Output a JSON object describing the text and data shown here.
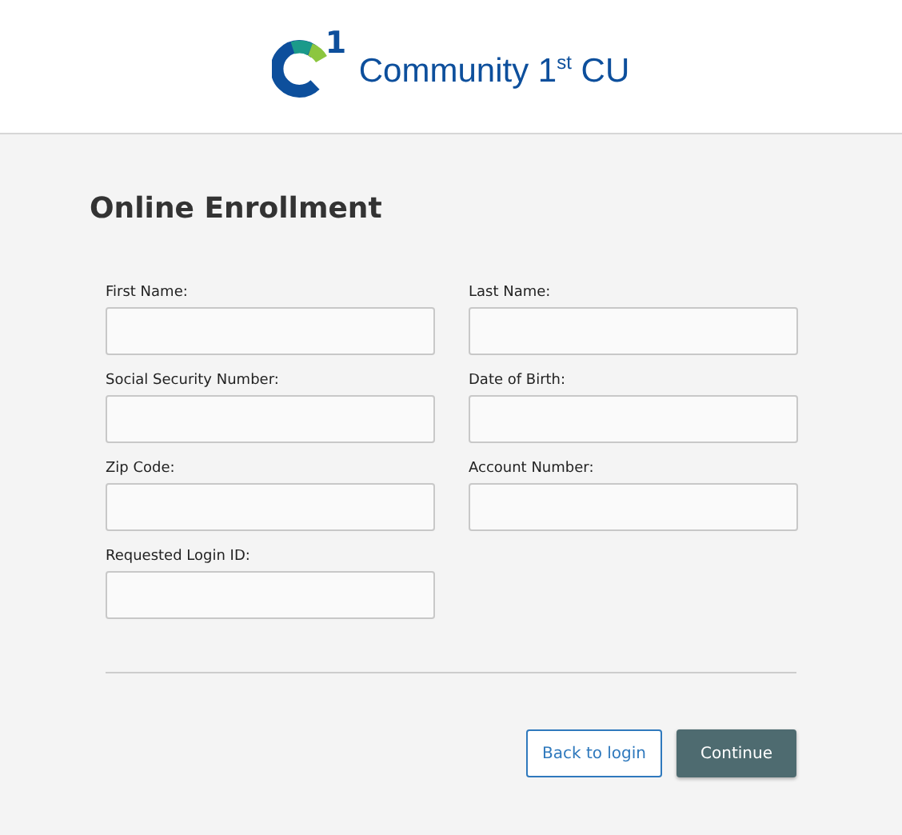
{
  "header": {
    "logo_mark": "1",
    "brand": "Community 1$^{st}$ CU"
  },
  "title": "Online Enrollment",
  "fields": [
    {
      "label": "First Name:"
    },
    {
      "label": "Last Name:"
    },
    {
      "label": "Social Security Number:"
    },
    {
      "label": "Date of Birth:"
    },
    {
      "label": "Zip Code:"
    },
    {
      "label": "Account Number:"
    },
    {
      "label": "Requested Login ID:"
    }
  ],
  "buttons": [
    {
      "label": "Back to login",
      "kind": "secondary"
    },
    {
      "label": "Continue",
      "kind": "primary"
    }
  ]
}
